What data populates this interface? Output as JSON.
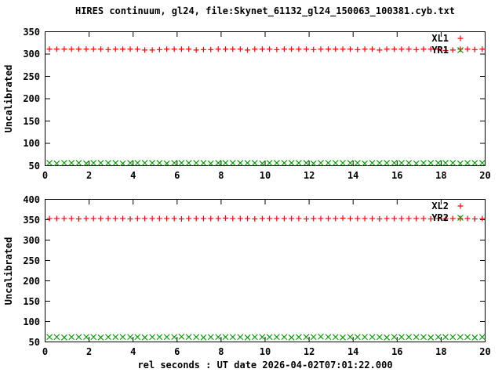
{
  "title": "HIRES continuum, gl24, file:Skynet_61132_gl24_150063_100381.cyb.txt",
  "xlabel": "rel seconds : UT date 2026-04-02T07:01:22.000",
  "colors": {
    "xl_series": "#ff0000",
    "yr_series": "#00a000",
    "text": "#000000",
    "background": "#ffffff",
    "border": "#000000"
  },
  "chart_data": [
    {
      "type": "scatter",
      "panel": "top",
      "ylabel": "Uncalibrated",
      "xlim": [
        0,
        20
      ],
      "ylim": [
        50,
        350
      ],
      "xticks": [
        0,
        2,
        4,
        6,
        8,
        10,
        12,
        14,
        16,
        18,
        20
      ],
      "yticks": [
        50,
        100,
        150,
        200,
        250,
        300,
        350
      ],
      "grid": false,
      "legend_position": "top-right-inside",
      "x": [
        0.2,
        0.53,
        0.87,
        1.2,
        1.53,
        1.87,
        2.2,
        2.53,
        2.87,
        3.2,
        3.53,
        3.87,
        4.2,
        4.53,
        4.87,
        5.2,
        5.53,
        5.87,
        6.2,
        6.53,
        6.87,
        7.2,
        7.53,
        7.87,
        8.2,
        8.53,
        8.87,
        9.2,
        9.53,
        9.87,
        10.2,
        10.53,
        10.87,
        11.2,
        11.53,
        11.87,
        12.2,
        12.53,
        12.87,
        13.2,
        13.53,
        13.87,
        14.2,
        14.53,
        14.87,
        15.2,
        15.53,
        15.87,
        16.2,
        16.53,
        16.87,
        17.2,
        17.53,
        17.87,
        18.2,
        18.53,
        18.87,
        19.2,
        19.53,
        19.87
      ],
      "series": [
        {
          "name": "XL1",
          "marker": "plus",
          "color": "#ff0000",
          "values": [
            311,
            311,
            311,
            311,
            311,
            311,
            311,
            311,
            310,
            311,
            311,
            311,
            311,
            309,
            309,
            310,
            311,
            311,
            311,
            311,
            309,
            310,
            310,
            311,
            311,
            311,
            311,
            309,
            311,
            311,
            311,
            310,
            311,
            311,
            311,
            311,
            310,
            311,
            311,
            311,
            311,
            311,
            310,
            311,
            311,
            309,
            311,
            311,
            311,
            311,
            310,
            311,
            311,
            311,
            308,
            309,
            311,
            311,
            310,
            311
          ]
        },
        {
          "name": "YR1",
          "marker": "cross",
          "color": "#00a000",
          "values": [
            56,
            55,
            56,
            56,
            56,
            55,
            56,
            56,
            56,
            56,
            55,
            56,
            56,
            56,
            56,
            56,
            55,
            56,
            56,
            56,
            56,
            56,
            55,
            56,
            56,
            56,
            56,
            56,
            56,
            55,
            56,
            56,
            56,
            56,
            56,
            56,
            55,
            56,
            56,
            56,
            56,
            56,
            56,
            55,
            56,
            56,
            56,
            56,
            56,
            56,
            55,
            56,
            56,
            56,
            56,
            56,
            55,
            56,
            56,
            56
          ]
        }
      ]
    },
    {
      "type": "scatter",
      "panel": "bottom",
      "ylabel": "Uncalibrated",
      "xlim": [
        0,
        20
      ],
      "ylim": [
        50,
        400
      ],
      "xticks": [
        0,
        2,
        4,
        6,
        8,
        10,
        12,
        14,
        16,
        18,
        20
      ],
      "yticks": [
        50,
        100,
        150,
        200,
        250,
        300,
        350,
        400
      ],
      "grid": false,
      "legend_position": "top-right-inside",
      "x": [
        0.2,
        0.53,
        0.87,
        1.2,
        1.53,
        1.87,
        2.2,
        2.53,
        2.87,
        3.2,
        3.53,
        3.87,
        4.2,
        4.53,
        4.87,
        5.2,
        5.53,
        5.87,
        6.2,
        6.53,
        6.87,
        7.2,
        7.53,
        7.87,
        8.2,
        8.53,
        8.87,
        9.2,
        9.53,
        9.87,
        10.2,
        10.53,
        10.87,
        11.2,
        11.53,
        11.87,
        12.2,
        12.53,
        12.87,
        13.2,
        13.53,
        13.87,
        14.2,
        14.53,
        14.87,
        15.2,
        15.53,
        15.87,
        16.2,
        16.53,
        16.87,
        17.2,
        17.53,
        17.87,
        18.2,
        18.53,
        18.87,
        19.2,
        19.53,
        19.87
      ],
      "series": [
        {
          "name": "XL2",
          "marker": "plus",
          "color": "#ff0000",
          "values": [
            353,
            353,
            353,
            353,
            352,
            353,
            353,
            353,
            353,
            353,
            353,
            352,
            353,
            353,
            353,
            353,
            353,
            353,
            352,
            353,
            353,
            353,
            353,
            353,
            354,
            353,
            353,
            353,
            352,
            353,
            353,
            353,
            353,
            353,
            353,
            352,
            353,
            353,
            353,
            353,
            354,
            353,
            353,
            353,
            353,
            352,
            353,
            353,
            353,
            353,
            353,
            353,
            352,
            353,
            353,
            353,
            353,
            353,
            352,
            353
          ]
        },
        {
          "name": "YR2",
          "marker": "cross",
          "color": "#00a000",
          "values": [
            62,
            62,
            61,
            62,
            62,
            62,
            62,
            61,
            62,
            62,
            62,
            62,
            62,
            61,
            62,
            62,
            62,
            62,
            63,
            62,
            62,
            61,
            62,
            62,
            62,
            62,
            62,
            61,
            62,
            62,
            62,
            62,
            62,
            61,
            62,
            62,
            62,
            63,
            62,
            62,
            61,
            62,
            62,
            62,
            62,
            62,
            61,
            62,
            62,
            62,
            62,
            62,
            61,
            62,
            62,
            62,
            62,
            62,
            61,
            62
          ]
        }
      ]
    }
  ]
}
